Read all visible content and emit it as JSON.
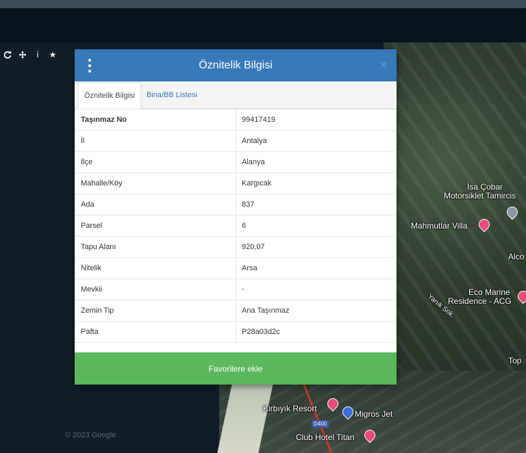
{
  "dialog": {
    "title": "Öznitelik Bilgisi",
    "close_icon": "×",
    "tabs": [
      {
        "label": "Öznitelik Bilgisi",
        "active": true
      },
      {
        "label": "Bina/BB Listesi",
        "active": false
      }
    ],
    "rows": [
      {
        "key": "Taşınmaz No",
        "value": "99417419"
      },
      {
        "key": "İl",
        "value": "Antalya"
      },
      {
        "key": "İlçe",
        "value": "Alanya"
      },
      {
        "key": "Mahalle/Köy",
        "value": "Kargıcak"
      },
      {
        "key": "Ada",
        "value": "837"
      },
      {
        "key": "Parsel",
        "value": "6"
      },
      {
        "key": "Tapu Alanı",
        "value": "920,07"
      },
      {
        "key": "Nitelik",
        "value": "Arsa"
      },
      {
        "key": "Mevkii",
        "value": "-"
      },
      {
        "key": "Zemin Tip",
        "value": "Ana Taşınmaz"
      },
      {
        "key": "Pafta",
        "value": "P28a03d2c"
      }
    ],
    "favorite_button": "Favorilere ekle"
  },
  "toolbar": {
    "icons": [
      "refresh-icon",
      "move-icon",
      "info-icon",
      "star-icon"
    ],
    "info_glyph": "i",
    "star_glyph": "★"
  },
  "map": {
    "labels": {
      "isa_cobar": "İsa Çobar",
      "motorsiklet": "Motorsiklet Tamircis",
      "mahmutlar_villa": "Mahmutlar Villa",
      "alco": "Alco",
      "eco_marine_1": "Eco Marine",
      "eco_marine_2": "Residence - ACG",
      "top": "Top",
      "yanik_sok": "Yanık Sok.",
      "kirbiyik": "Kirbıyık Resort",
      "migros": "Migros Jet",
      "club_hotel": "Club Hotel Titan",
      "road_code": "D400",
      "copyright": "© 2023 Google"
    }
  },
  "colors": {
    "header_blue": "#3779b8",
    "favorite_green": "#5cb85c",
    "pin_pink": "#e84a7a"
  }
}
